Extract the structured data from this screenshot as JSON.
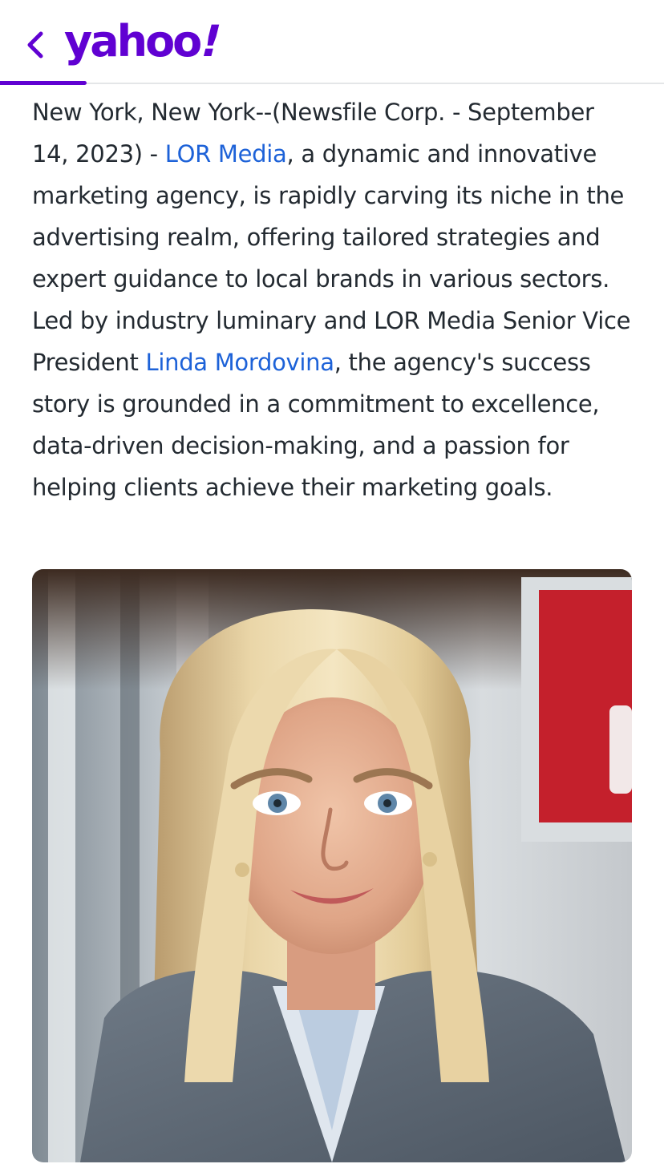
{
  "header": {
    "back_icon": "chevron-left-icon",
    "logo_text": "yahoo",
    "logo_mark": "!",
    "brand_color": "#6001d2",
    "read_progress_percent": 13
  },
  "article": {
    "para_start": "New York, New York--(Newsfile Corp. - September 14, 2023) -  ",
    "link_company": "LOR Media",
    "para_mid": ", a dynamic and innovative marketing agency, is rapidly carving its niche in the advertising realm, offering tailored strategies and expert guidance to local brands in various sectors. Led by industry luminary and LOR Media Senior Vice President ",
    "link_person": "Linda Mordovina",
    "para_end": ", the agency's success story is grounded in a commitment to excellence, data-driven decision-making, and a passion for helping clients achieve their marketing goals.",
    "link_color": "#1d62d8"
  },
  "image": {
    "subject": "portrait-photo"
  }
}
